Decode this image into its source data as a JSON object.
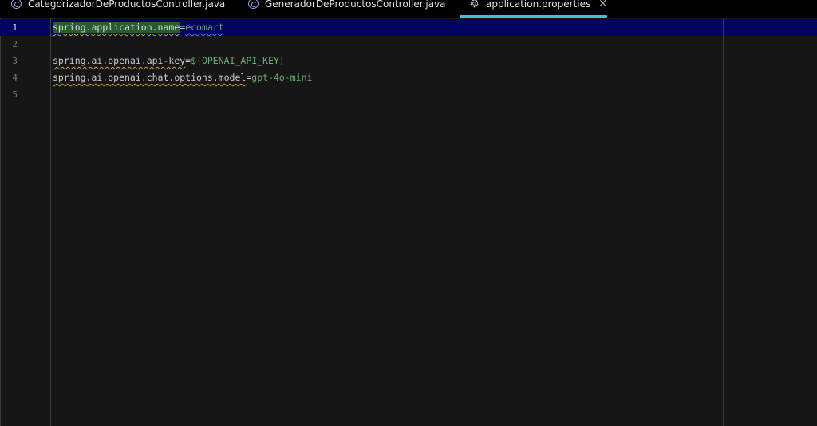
{
  "tabs": [
    {
      "label": "CategorizadorDeProductosController.java",
      "icon": "class-icon",
      "active": false
    },
    {
      "label": "GeneradorDeProductosController.java",
      "icon": "class-icon",
      "active": false
    },
    {
      "label": "application.properties",
      "icon": "gear-icon",
      "active": true,
      "close": "×"
    }
  ],
  "editor": {
    "lines": [
      {
        "number": "1",
        "key": "spring.application.name",
        "eq": "=",
        "value": "ecomart"
      },
      {
        "number": "2"
      },
      {
        "number": "3",
        "key": "spring.ai.openai.api-key",
        "eq": "=",
        "value": "${OPENAI_API_KEY}"
      },
      {
        "number": "4",
        "key": "spring.ai.openai.chat.options.model",
        "eq": "=",
        "value": "gpt-4o-mini"
      },
      {
        "number": "5"
      }
    ]
  },
  "colors": {
    "accent_tab_underline": "#3ec1d3",
    "current_line": "#030361",
    "value_green": "#6aab73",
    "background": "#161616"
  }
}
